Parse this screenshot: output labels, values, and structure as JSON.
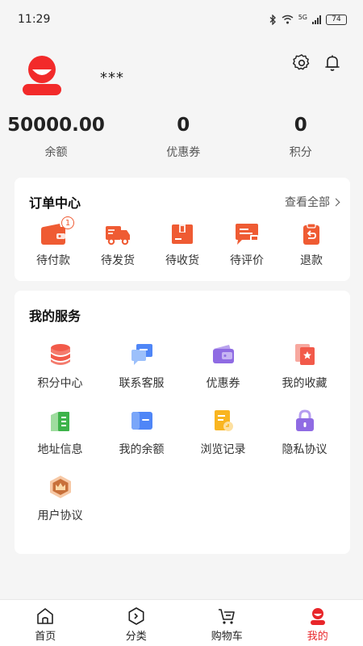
{
  "status": {
    "time": "11:29",
    "network": "5G",
    "battery": "74"
  },
  "profile": {
    "username": "***"
  },
  "stats": [
    {
      "value": "50000.00",
      "label": "余额"
    },
    {
      "value": "0",
      "label": "优惠券"
    },
    {
      "value": "0",
      "label": "积分"
    }
  ],
  "orders": {
    "title": "订单中心",
    "see_all": "查看全部",
    "items": [
      {
        "label": "待付款",
        "icon": "wallet-icon",
        "badge": "1"
      },
      {
        "label": "待发货",
        "icon": "truck-icon"
      },
      {
        "label": "待收货",
        "icon": "box-icon"
      },
      {
        "label": "待评价",
        "icon": "comment-icon"
      },
      {
        "label": "退款",
        "icon": "refund-icon"
      }
    ]
  },
  "services": {
    "title": "我的服务",
    "items": [
      {
        "label": "积分中心",
        "icon": "points-icon"
      },
      {
        "label": "联系客服",
        "icon": "chat-icon"
      },
      {
        "label": "优惠券",
        "icon": "coupon-icon"
      },
      {
        "label": "我的收藏",
        "icon": "favorite-icon"
      },
      {
        "label": "地址信息",
        "icon": "address-icon"
      },
      {
        "label": "我的余额",
        "icon": "balance-icon"
      },
      {
        "label": "浏览记录",
        "icon": "history-icon"
      },
      {
        "label": "隐私协议",
        "icon": "lock-icon"
      },
      {
        "label": "用户协议",
        "icon": "crown-icon"
      }
    ]
  },
  "tabs": [
    {
      "label": "首页",
      "icon": "home-icon"
    },
    {
      "label": "分类",
      "icon": "category-icon"
    },
    {
      "label": "购物车",
      "icon": "cart-icon"
    },
    {
      "label": "我的",
      "icon": "profile-icon",
      "active": true
    }
  ],
  "colors": {
    "accent": "#e8262a",
    "order_icon": "#ef5b33"
  }
}
